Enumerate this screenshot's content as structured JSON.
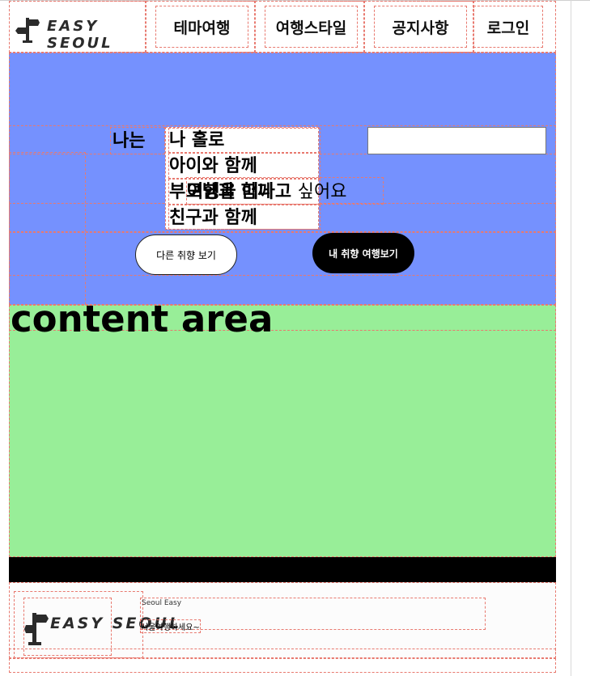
{
  "header": {
    "logo_text": "EASY SEOUL",
    "nav": [
      {
        "label": "테마여행"
      },
      {
        "label": "여행스타일"
      },
      {
        "label": "공지사항"
      },
      {
        "label": "로그인"
      }
    ]
  },
  "hero": {
    "prefix": "나는",
    "options": [
      "나 홀로",
      "아이와 함께",
      "부모님과 함께",
      "친구과 함께"
    ],
    "overlap_text": "여행을 떠나고",
    "suffix": "싶어요",
    "search_value": "",
    "btn_other": "다른 취향 보기",
    "btn_mine": "내 취향 여행보기"
  },
  "content": {
    "title": "content area"
  },
  "footer": {
    "logo_text": "EASY SEOUL",
    "line1": "Seoul Easy",
    "line2": "서울여행하세요~"
  },
  "colors": {
    "hero_bg": "#7591fe",
    "content_bg": "#98ee98",
    "bar_bg": "#000000",
    "outline": "#e8796f"
  }
}
